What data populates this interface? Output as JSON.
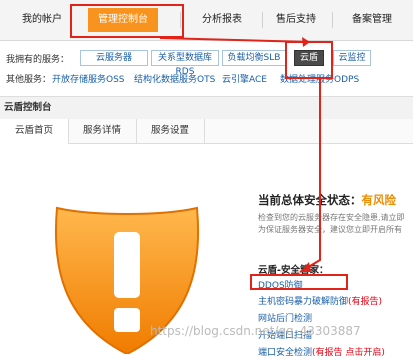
{
  "topnav": {
    "tabs": [
      {
        "label": "我的帐户"
      },
      {
        "label": "管理控制台"
      },
      {
        "label": "分析报表"
      },
      {
        "label": "售后支持"
      },
      {
        "label": "备案管理"
      }
    ]
  },
  "services": {
    "owned_label": "我拥有的服务：",
    "owned": [
      "云服务器",
      "关系型数据库RDS",
      "负载均衡SLB",
      "云盾",
      "云监控"
    ],
    "other_label": "其他服务：",
    "other": [
      "开放存储服务OSS",
      "结构化数据服务OTS",
      "云引擎ACE",
      "数据处理服务ODPS"
    ]
  },
  "panel": {
    "title": "云盾控制台",
    "tabs": [
      "云盾首页",
      "服务详情",
      "服务设置"
    ]
  },
  "status": {
    "prefix": "当前总体安全状态：",
    "value": "有风险",
    "desc_line1": "检查到您的云服务器存在安全隐患,请立即",
    "desc_line2": "为保证服务器安全，建议您立即开启所有"
  },
  "security": {
    "title": "云盾-安全管家：",
    "items": [
      {
        "label": "DDOS防御",
        "tag": ""
      },
      {
        "label": "主机密码暴力破解防御",
        "tag": "(有报告)"
      },
      {
        "label": "网站后门检测",
        "tag": ""
      },
      {
        "label": "开始端口扫描",
        "tag": ""
      },
      {
        "label": "端口安全检测",
        "tag": "(有报告 点击开启)"
      }
    ]
  },
  "watermark": "https://blog.csdn.net/qq_43303887",
  "colors": {
    "accent": "#f7931e",
    "link": "#1a5fa8",
    "highlight": "#e2231a",
    "risk": "#f08c00"
  }
}
